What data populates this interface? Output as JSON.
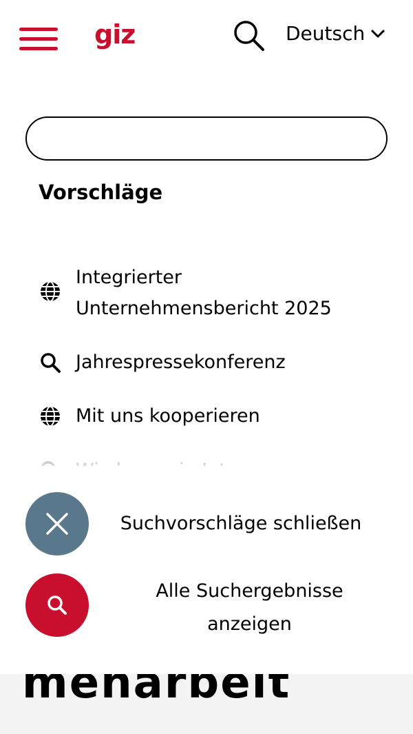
{
  "header": {
    "logo": "giz",
    "language": "Deutsch"
  },
  "search": {
    "value": "",
    "placeholder": ""
  },
  "suggestions": {
    "title": "Vorschläge",
    "items": [
      {
        "icon": "globe-icon",
        "label": "Integrierter Unternehmensbericht 2025"
      },
      {
        "icon": "search-icon",
        "label": "Jahrespressekonferenz"
      },
      {
        "icon": "globe-icon",
        "label": "Mit uns kooperieren"
      },
      {
        "icon": "search-icon",
        "label": "Wie kann ein Interesse"
      }
    ]
  },
  "actions": {
    "close_label": "Suchvorschläge schließen",
    "all_results_label": "Alle Suchergebnisse anzeigen"
  },
  "background_page": {
    "heading": "menarbeit"
  },
  "colors": {
    "brand_red": "#c8102e",
    "close_button": "#5a788b"
  }
}
